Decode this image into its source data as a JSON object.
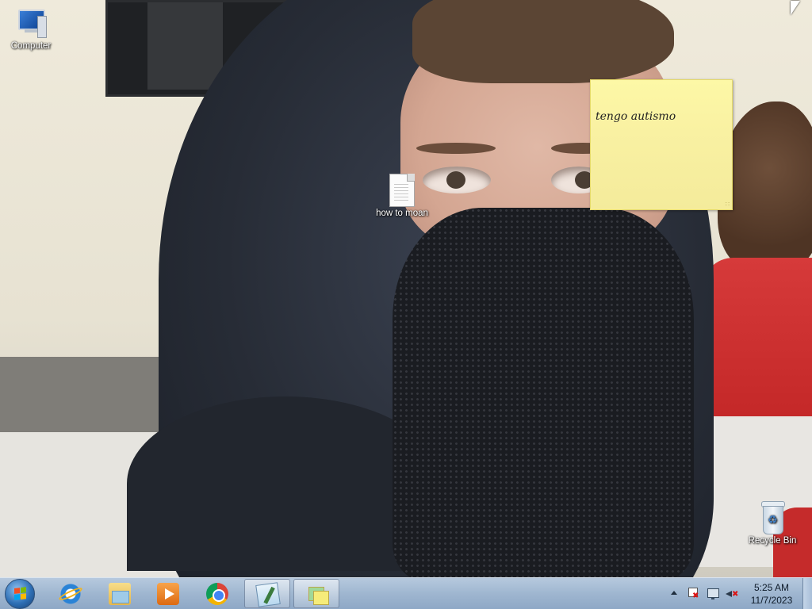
{
  "desktop": {
    "icons": [
      {
        "label": "Computer",
        "icon": "computer-icon"
      },
      {
        "label": "how to moan",
        "icon": "text-file-icon"
      },
      {
        "label": "Recycle Bin",
        "icon": "recycle-bin-icon"
      }
    ]
  },
  "sticky_note": {
    "text": "tengo autismo",
    "color": "#fbf5a3"
  },
  "taskbar": {
    "start_button": "windows-start-icon",
    "pinned": [
      {
        "app": "Internet Explorer",
        "icon": "internet-explorer-icon",
        "active": false
      },
      {
        "app": "Windows Explorer",
        "icon": "folder-explorer-icon",
        "active": false
      },
      {
        "app": "Windows Media Player",
        "icon": "media-player-icon",
        "active": false
      },
      {
        "app": "Google Chrome",
        "icon": "chrome-icon",
        "active": false
      },
      {
        "app": "Notepad",
        "icon": "notepad-icon",
        "active": true
      },
      {
        "app": "Sticky Notes",
        "icon": "sticky-notes-icon",
        "active": true
      }
    ],
    "tray": {
      "icons": [
        "show-hidden-icons-arrow",
        "action-center-flag-icon",
        "network-icon",
        "volume-muted-icon"
      ],
      "time": "5:25 AM",
      "date": "11/7/2023"
    }
  }
}
